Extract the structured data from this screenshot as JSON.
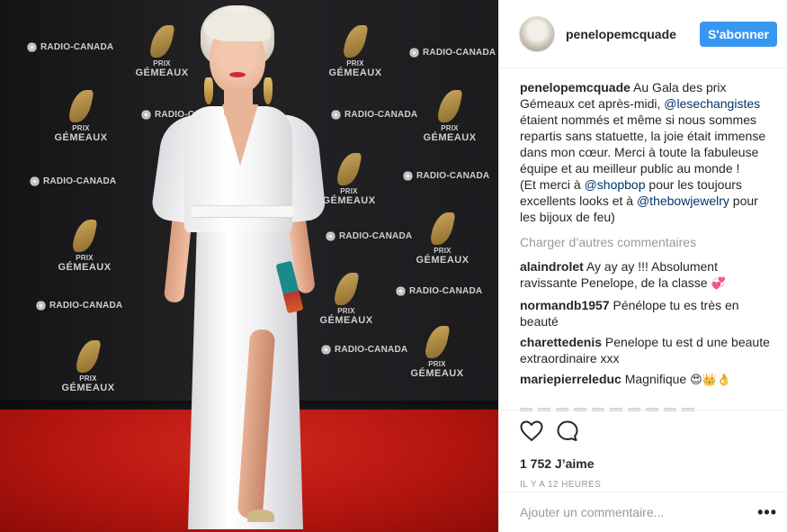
{
  "post": {
    "username": "penelopemcquade",
    "follow_label": "S'abonner",
    "caption": {
      "user": "penelopemcquade",
      "text_1": " Au Gala des prix Gémeaux cet après-midi, ",
      "mention_1": "@lesechangistes",
      "text_2": " étaient nommés et même si nous sommes repartis sans statuette, la joie était immense dans mon cœur. Merci à toute la fabuleuse équipe et au meilleur public au monde !",
      "text_3": "(Et merci à ",
      "mention_2": "@shopbop",
      "text_4": " pour les toujours excellents looks et à ",
      "mention_3": "@thebowjewelry",
      "text_5": " pour les bijoux de feu)"
    },
    "load_more": "Charger d’autres commentaires",
    "comments": [
      {
        "user": "alaindrolet",
        "text": " Ay ay ay !!! Absolument ravissante Penelope, de la classe ",
        "emoji": "💞"
      },
      {
        "user": "normandb1957",
        "text": " Pénélope tu es très en beauté",
        "emoji": ""
      },
      {
        "user": "charettedenis",
        "text": " Penelope tu est d une beaute extraordinaire xxx",
        "emoji": ""
      },
      {
        "user": "mariepierreleduc",
        "text": " Magnifique ",
        "emoji": "😍👑👌"
      }
    ],
    "likes": "1 752 J’aime",
    "timestamp": "IL Y A 12 HEURES",
    "add_comment_placeholder": "Ajouter un commentaire...",
    "more_options": "•••"
  },
  "backdrop_logos": {
    "radio_canada": "RADIO-CANADA",
    "prix_line": "PRIX",
    "gemeaux_line": "GÉMEAUX"
  },
  "icons": {
    "like": "heart-icon",
    "comment": "comment-bubble-icon",
    "options": "more-options-icon"
  },
  "colors": {
    "accent": "#3897f0",
    "mention": "#003569",
    "muted": "#999999",
    "carpet": "#c41d16"
  }
}
